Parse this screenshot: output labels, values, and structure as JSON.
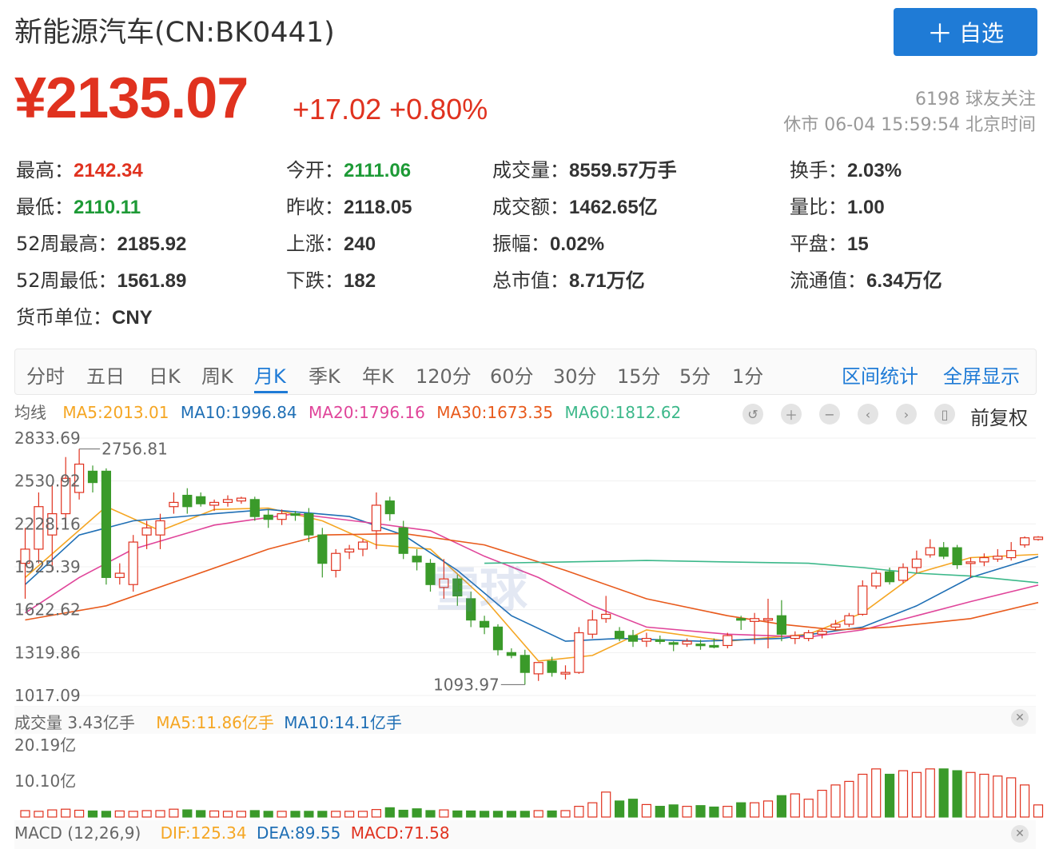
{
  "header": {
    "title": "新能源汽车(CN:BK0441)",
    "follow_button": "自选",
    "price": "¥2135.07",
    "change": "+17.02 +0.80%",
    "followers": "6198 球友关注",
    "status": "休市 06-04 15:59:54 北京时间"
  },
  "stats": {
    "high_label": "最高：",
    "high": "2142.34",
    "open_label": "今开：",
    "open": "2111.06",
    "volume_label": "成交量：",
    "volume": "8559.57万手",
    "turnover_label": "换手：",
    "turnover": "2.03%",
    "low_label": "最低：",
    "low": "2110.11",
    "prev_close_label": "昨收：",
    "prev_close": "2118.05",
    "amount_label": "成交额：",
    "amount": "1462.65亿",
    "volume_ratio_label": "量比：",
    "volume_ratio": "1.00",
    "high52_label": "52周最高：",
    "high52": "2185.92",
    "up_label": "上涨：",
    "up": "240",
    "amplitude_label": "振幅：",
    "amplitude": "0.02%",
    "flat_label": "平盘：",
    "flat": "15",
    "low52_label": "52周最低：",
    "low52": "1561.89",
    "down_label": "下跌：",
    "down": "182",
    "mktcap_label": "总市值：",
    "mktcap": "8.71万亿",
    "float_label": "流通值：",
    "float": "6.34万亿",
    "currency_label": "货币单位：",
    "currency": "CNY"
  },
  "tabs": [
    "分时",
    "五日",
    "日K",
    "周K",
    "月K",
    "季K",
    "年K",
    "120分",
    "60分",
    "30分",
    "15分",
    "5分",
    "1分"
  ],
  "active_tab": "月K",
  "links": {
    "range_stats": "区间统计",
    "fullscreen": "全屏显示"
  },
  "ma_legend": {
    "label": "均线",
    "ma5": "MA5:2013.01",
    "ma10": "MA10:1996.84",
    "ma20": "MA20:1796.16",
    "ma30": "MA30:1673.35",
    "ma60": "MA60:1812.62"
  },
  "adjust_label": "前复权",
  "watermark": "雪球",
  "volume_legend": {
    "label": "成交量 3.43亿手",
    "ma5": "MA5:11.86亿手",
    "ma10": "MA10:14.1亿手"
  },
  "macd_legend": {
    "label": "MACD (12,26,9)",
    "dif": "DIF:125.34",
    "dea": "DEA:89.55",
    "macd": "MACD:71.58"
  },
  "colors": {
    "up": "#e0321f",
    "down": "#3a9a2a",
    "accent": "#1f7bd6",
    "ma5": "#f5a623",
    "ma10": "#1f6fb5",
    "ma20": "#e0459a",
    "ma30": "#e85a1c",
    "ma60": "#3cb88a"
  },
  "chart_data": {
    "type": "candlestick",
    "y_ticks": [
      "2833.69",
      "2530.92",
      "2228.16",
      "1925.39",
      "1622.62",
      "1319.86",
      "1017.09"
    ],
    "ylim": [
      1017.09,
      2833.69
    ],
    "annotations": {
      "max_label": "2756.81",
      "min_label": "1093.97"
    },
    "volume_ticks": [
      "20.19亿",
      "10.10亿"
    ],
    "volume_ylim": [
      0,
      20.19
    ],
    "candles": [
      {
        "o": 1950,
        "h": 2200,
        "l": 1700,
        "c": 2050
      },
      {
        "o": 2050,
        "h": 2450,
        "l": 1950,
        "c": 2350
      },
      {
        "o": 2150,
        "h": 2500,
        "l": 1900,
        "c": 2300
      },
      {
        "o": 2300,
        "h": 2700,
        "l": 2200,
        "c": 2550
      },
      {
        "o": 2450,
        "h": 2757,
        "l": 2400,
        "c": 2650
      },
      {
        "o": 2600,
        "h": 2640,
        "l": 2450,
        "c": 2520
      },
      {
        "o": 2600,
        "h": 2620,
        "l": 1800,
        "c": 1850
      },
      {
        "o": 1850,
        "h": 1950,
        "l": 1800,
        "c": 1880
      },
      {
        "o": 1800,
        "h": 2150,
        "l": 1750,
        "c": 2100
      },
      {
        "o": 2150,
        "h": 2250,
        "l": 2050,
        "c": 2200
      },
      {
        "o": 2150,
        "h": 2300,
        "l": 2050,
        "c": 2250
      },
      {
        "o": 2350,
        "h": 2450,
        "l": 2300,
        "c": 2380
      },
      {
        "o": 2430,
        "h": 2480,
        "l": 2300,
        "c": 2350
      },
      {
        "o": 2420,
        "h": 2450,
        "l": 2350,
        "c": 2370
      },
      {
        "o": 2360,
        "h": 2400,
        "l": 2320,
        "c": 2380
      },
      {
        "o": 2380,
        "h": 2430,
        "l": 2350,
        "c": 2400
      },
      {
        "o": 2390,
        "h": 2420,
        "l": 2370,
        "c": 2410
      },
      {
        "o": 2400,
        "h": 2420,
        "l": 2250,
        "c": 2280
      },
      {
        "o": 2290,
        "h": 2330,
        "l": 2200,
        "c": 2260
      },
      {
        "o": 2260,
        "h": 2330,
        "l": 2220,
        "c": 2300
      },
      {
        "o": 2300,
        "h": 2320,
        "l": 2250,
        "c": 2290
      },
      {
        "o": 2300,
        "h": 2340,
        "l": 2100,
        "c": 2150
      },
      {
        "o": 2150,
        "h": 2200,
        "l": 1850,
        "c": 1950
      },
      {
        "o": 1900,
        "h": 2050,
        "l": 1850,
        "c": 2020
      },
      {
        "o": 2030,
        "h": 2080,
        "l": 1980,
        "c": 2050
      },
      {
        "o": 2050,
        "h": 2120,
        "l": 2000,
        "c": 2100
      },
      {
        "o": 2180,
        "h": 2450,
        "l": 2050,
        "c": 2360
      },
      {
        "o": 2390,
        "h": 2420,
        "l": 2250,
        "c": 2300
      },
      {
        "o": 2200,
        "h": 2250,
        "l": 1980,
        "c": 2020
      },
      {
        "o": 2000,
        "h": 2050,
        "l": 1900,
        "c": 1960
      },
      {
        "o": 1950,
        "h": 1980,
        "l": 1750,
        "c": 1800
      },
      {
        "o": 1780,
        "h": 1980,
        "l": 1700,
        "c": 1840
      },
      {
        "o": 1840,
        "h": 1870,
        "l": 1650,
        "c": 1720
      },
      {
        "o": 1700,
        "h": 1750,
        "l": 1500,
        "c": 1550
      },
      {
        "o": 1540,
        "h": 1580,
        "l": 1450,
        "c": 1500
      },
      {
        "o": 1500,
        "h": 1520,
        "l": 1300,
        "c": 1340
      },
      {
        "o": 1320,
        "h": 1350,
        "l": 1280,
        "c": 1300
      },
      {
        "o": 1300,
        "h": 1340,
        "l": 1094,
        "c": 1180
      },
      {
        "o": 1170,
        "h": 1250,
        "l": 1120,
        "c": 1250
      },
      {
        "o": 1260,
        "h": 1290,
        "l": 1150,
        "c": 1180
      },
      {
        "o": 1170,
        "h": 1230,
        "l": 1130,
        "c": 1180
      },
      {
        "o": 1180,
        "h": 1500,
        "l": 1170,
        "c": 1460
      },
      {
        "o": 1450,
        "h": 1620,
        "l": 1420,
        "c": 1550
      },
      {
        "o": 1560,
        "h": 1720,
        "l": 1530,
        "c": 1590
      },
      {
        "o": 1470,
        "h": 1500,
        "l": 1400,
        "c": 1420
      },
      {
        "o": 1440,
        "h": 1480,
        "l": 1360,
        "c": 1400
      },
      {
        "o": 1400,
        "h": 1460,
        "l": 1360,
        "c": 1420
      },
      {
        "o": 1410,
        "h": 1440,
        "l": 1380,
        "c": 1400
      },
      {
        "o": 1390,
        "h": 1400,
        "l": 1330,
        "c": 1380
      },
      {
        "o": 1380,
        "h": 1420,
        "l": 1360,
        "c": 1400
      },
      {
        "o": 1380,
        "h": 1410,
        "l": 1340,
        "c": 1370
      },
      {
        "o": 1370,
        "h": 1420,
        "l": 1350,
        "c": 1360
      },
      {
        "o": 1370,
        "h": 1460,
        "l": 1350,
        "c": 1440
      },
      {
        "o": 1560,
        "h": 1580,
        "l": 1480,
        "c": 1550
      },
      {
        "o": 1540,
        "h": 1600,
        "l": 1380,
        "c": 1560
      },
      {
        "o": 1550,
        "h": 1700,
        "l": 1350,
        "c": 1560
      },
      {
        "o": 1580,
        "h": 1690,
        "l": 1400,
        "c": 1450
      },
      {
        "o": 1420,
        "h": 1470,
        "l": 1380,
        "c": 1440
      },
      {
        "o": 1420,
        "h": 1480,
        "l": 1400,
        "c": 1460
      },
      {
        "o": 1450,
        "h": 1490,
        "l": 1420,
        "c": 1470
      },
      {
        "o": 1500,
        "h": 1550,
        "l": 1480,
        "c": 1520
      },
      {
        "o": 1520,
        "h": 1600,
        "l": 1500,
        "c": 1580
      },
      {
        "o": 1590,
        "h": 1830,
        "l": 1580,
        "c": 1790
      },
      {
        "o": 1790,
        "h": 1900,
        "l": 1770,
        "c": 1880
      },
      {
        "o": 1890,
        "h": 1920,
        "l": 1800,
        "c": 1820
      },
      {
        "o": 1830,
        "h": 1950,
        "l": 1810,
        "c": 1920
      },
      {
        "o": 1920,
        "h": 2040,
        "l": 1880,
        "c": 1980
      },
      {
        "o": 2010,
        "h": 2120,
        "l": 1990,
        "c": 2060
      },
      {
        "o": 2060,
        "h": 2100,
        "l": 1980,
        "c": 2000
      },
      {
        "o": 2060,
        "h": 2080,
        "l": 1910,
        "c": 1940
      },
      {
        "o": 1960,
        "h": 1990,
        "l": 1850,
        "c": 1960
      },
      {
        "o": 1960,
        "h": 2020,
        "l": 1930,
        "c": 1990
      },
      {
        "o": 1980,
        "h": 2050,
        "l": 1960,
        "c": 2000
      },
      {
        "o": 1990,
        "h": 2100,
        "l": 1970,
        "c": 2040
      },
      {
        "o": 2080,
        "h": 2140,
        "l": 2060,
        "c": 2130
      },
      {
        "o": 2118,
        "h": 2142,
        "l": 2110,
        "c": 2135
      }
    ],
    "ma_series": [
      {
        "name": "MA5",
        "color": "#f5a623",
        "values": [
          [
            0,
            1850
          ],
          [
            6,
            2350
          ],
          [
            10,
            2180
          ],
          [
            14,
            2330
          ],
          [
            18,
            2340
          ],
          [
            22,
            2250
          ],
          [
            26,
            2080
          ],
          [
            30,
            2050
          ],
          [
            34,
            1700
          ],
          [
            38,
            1260
          ],
          [
            42,
            1300
          ],
          [
            46,
            1480
          ],
          [
            52,
            1400
          ],
          [
            58,
            1450
          ],
          [
            62,
            1600
          ],
          [
            66,
            1880
          ],
          [
            70,
            1990
          ],
          [
            75,
            2013
          ]
        ]
      },
      {
        "name": "MA10",
        "color": "#1f6fb5",
        "values": [
          [
            0,
            1800
          ],
          [
            4,
            2150
          ],
          [
            8,
            2250
          ],
          [
            14,
            2300
          ],
          [
            18,
            2330
          ],
          [
            24,
            2280
          ],
          [
            28,
            2150
          ],
          [
            32,
            1900
          ],
          [
            36,
            1580
          ],
          [
            40,
            1400
          ],
          [
            44,
            1420
          ],
          [
            50,
            1400
          ],
          [
            56,
            1420
          ],
          [
            62,
            1500
          ],
          [
            66,
            1650
          ],
          [
            70,
            1850
          ],
          [
            75,
            1997
          ]
        ]
      },
      {
        "name": "MA20",
        "color": "#e0459a",
        "values": [
          [
            0,
            1600
          ],
          [
            4,
            1850
          ],
          [
            8,
            2050
          ],
          [
            14,
            2220
          ],
          [
            20,
            2300
          ],
          [
            26,
            2230
          ],
          [
            30,
            2180
          ],
          [
            34,
            2000
          ],
          [
            38,
            1850
          ],
          [
            42,
            1650
          ],
          [
            46,
            1500
          ],
          [
            52,
            1450
          ],
          [
            58,
            1430
          ],
          [
            62,
            1480
          ],
          [
            66,
            1580
          ],
          [
            70,
            1680
          ],
          [
            75,
            1796
          ]
        ]
      },
      {
        "name": "MA30",
        "color": "#e85a1c",
        "values": [
          [
            0,
            1550
          ],
          [
            6,
            1650
          ],
          [
            12,
            1850
          ],
          [
            18,
            2050
          ],
          [
            22,
            2150
          ],
          [
            28,
            2160
          ],
          [
            34,
            2080
          ],
          [
            40,
            1900
          ],
          [
            46,
            1700
          ],
          [
            52,
            1580
          ],
          [
            56,
            1520
          ],
          [
            60,
            1480
          ],
          [
            64,
            1500
          ],
          [
            70,
            1560
          ],
          [
            75,
            1673
          ]
        ]
      },
      {
        "name": "MA60",
        "color": "#3cb88a",
        "values": [
          [
            34,
            1950
          ],
          [
            40,
            1960
          ],
          [
            46,
            1970
          ],
          [
            52,
            1960
          ],
          [
            58,
            1950
          ],
          [
            62,
            1920
          ],
          [
            66,
            1880
          ],
          [
            70,
            1860
          ],
          [
            75,
            1813
          ]
        ]
      }
    ],
    "volume": [
      1.8,
      1.6,
      2.0,
      2.2,
      1.9,
      1.7,
      1.6,
      1.7,
      1.6,
      1.8,
      1.8,
      2.2,
      2.0,
      1.8,
      1.7,
      1.6,
      1.6,
      1.8,
      1.6,
      1.6,
      1.6,
      1.6,
      1.6,
      1.6,
      1.6,
      1.6,
      2.1,
      2.6,
      1.9,
      2.3,
      1.8,
      2.0,
      1.7,
      1.7,
      1.6,
      1.6,
      1.6,
      1.6,
      1.8,
      1.7,
      1.8,
      3.0,
      4.0,
      7.0,
      4.5,
      5.0,
      3.5,
      3.0,
      3.4,
      3.0,
      3.2,
      2.8,
      3.0,
      4.0,
      4.0,
      4.5,
      6.0,
      6.5,
      5.0,
      7.5,
      9.0,
      10.0,
      12.0,
      13.5,
      12.0,
      13.0,
      12.5,
      13.5,
      13.5,
      13.0,
      12.5,
      12.0,
      11.5,
      11.0,
      9.0,
      3.4
    ]
  }
}
